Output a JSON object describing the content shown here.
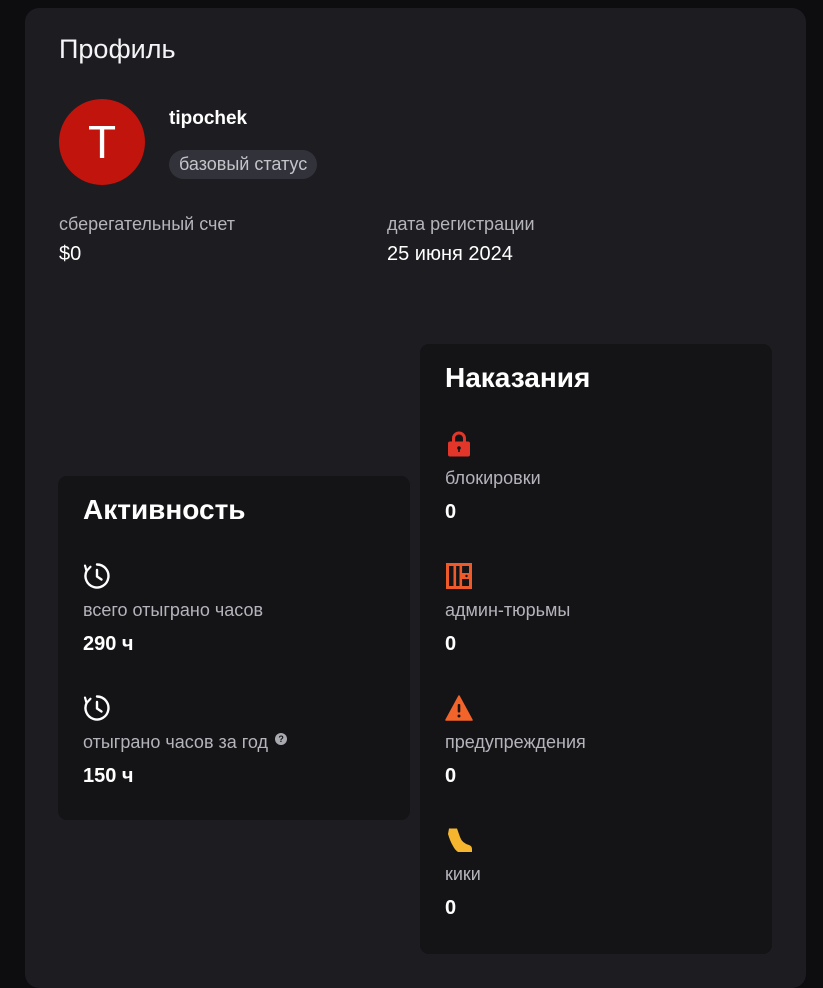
{
  "profile": {
    "title": "Профиль",
    "avatar_letter": "T",
    "username": "tipochek",
    "status": "базовый статус",
    "savings_label": "сберегательный счет",
    "savings_value": "$0",
    "registration_label": "дата регистрации",
    "registration_value": "25 июня 2024"
  },
  "activity": {
    "title": "Активность",
    "items": [
      {
        "icon": "clock-icon",
        "label": "всего отыграно часов",
        "value": "290 ч"
      },
      {
        "icon": "clock-icon",
        "label": "отыграно часов за год",
        "value": "150 ч",
        "help": "?"
      }
    ]
  },
  "punishments": {
    "title": "Наказания",
    "items": [
      {
        "icon": "lock-icon",
        "label": "блокировки",
        "value": "0",
        "color": "#e2362a"
      },
      {
        "icon": "jail-icon",
        "label": "админ-тюрьмы",
        "value": "0",
        "color": "#ef5a2b"
      },
      {
        "icon": "warning-icon",
        "label": "предупреждения",
        "value": "0",
        "color": "#f3642a"
      },
      {
        "icon": "boot-icon",
        "label": "кики",
        "value": "0",
        "color": "#f6b52e"
      }
    ]
  },
  "colors": {
    "background": "#0d0d10",
    "panel": "#1c1c21",
    "card": "#141417",
    "avatar": "#c0140d",
    "badge": "#32323a"
  }
}
